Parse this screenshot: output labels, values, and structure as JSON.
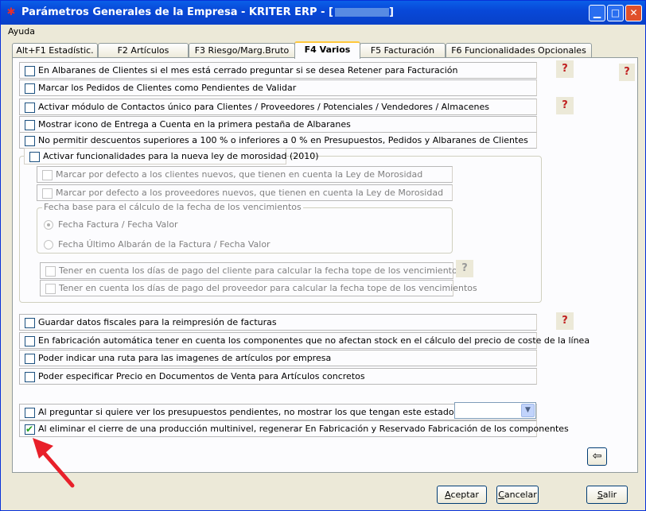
{
  "window": {
    "title": "Parámetros Generales de la Empresa - KRITER ERP - [",
    "title_suffix": "]",
    "minimize_icon": "minimize-icon",
    "maximize_icon": "maximize-icon",
    "close_icon": "close-icon",
    "min_glyph": "▁",
    "max_glyph": "□",
    "close_glyph": "✕"
  },
  "menu": {
    "ayuda": "Ayuda"
  },
  "tabs": [
    {
      "label": "Alt+F1 Estadístic."
    },
    {
      "label": "F2 Artículos"
    },
    {
      "label": "F3 Riesgo/Marg.Bruto"
    },
    {
      "label": "F4 Varios"
    },
    {
      "label": "F5 Facturación"
    },
    {
      "label": "F6 Funcionalidades Opcionales"
    }
  ],
  "options": {
    "o1": "En Albaranes de Clientes si el mes está cerrado preguntar si se desea Retener para Facturación",
    "o2": "Marcar los Pedidos de Clientes como Pendientes de Validar",
    "o3": "Activar módulo de Contactos único para Clientes / Proveedores / Potenciales / Vendedores / Almacenes",
    "o4": "Mostrar icono de Entrega a Cuenta en la primera pestaña de Albaranes",
    "o5": "No permitir descuentos superiores a 100 % o inferiores a 0 % en Presupuestos, Pedidos y Albaranes de Clientes",
    "morosidad": "Activar funcionalidades para la nueva ley de morosidad (2010)",
    "m1": "Marcar por defecto a los clientes nuevos, que tienen en cuenta la Ley de Morosidad",
    "m2": "Marcar por defecto a los proveedores nuevos, que tienen en cuenta la Ley de Morosidad",
    "fecha_legend": "Fecha base para el cálculo de la fecha de los vencimientos",
    "r1": "Fecha Factura / Fecha Valor",
    "r2": "Fecha Último Albarán de la Factura / Fecha Valor",
    "m3": "Tener en cuenta los días de pago del cliente para calcular la fecha tope de los vencimientos",
    "m4": "Tener en cuenta los días de pago del proveedor para calcular la fecha tope de los vencimientos",
    "o6": "Guardar datos fiscales para la reimpresión de facturas",
    "o7": "En fabricación automática tener en cuenta los componentes que no afectan stock en el cálculo del precio de coste de la línea",
    "o8": "Poder indicar una ruta para las imagenes de artículos por empresa",
    "o9": "Poder especificar Precio en Documentos de Venta para Artículos concretos",
    "o10": "Al preguntar si quiere ver los presupuestos pendientes, no mostrar los que tengan este estado",
    "o11": "Al eliminar el cierre de una producción multinivel, regenerar En Fabricación y Reservado Fabricación de los componentes"
  },
  "o11_checked": true,
  "combo_value": "",
  "combo_glyph": "▼",
  "help_glyph": "?",
  "back_glyph": "⇦",
  "buttons": {
    "aceptar_u": "A",
    "aceptar_rest": "ceptar",
    "cancelar_u": "C",
    "cancelar_rest": "ancelar",
    "salir_u": "S",
    "salir_rest": "alir"
  },
  "colors": {
    "titlebar": "#0848d8",
    "annotation_arrow": "#e8202a"
  }
}
